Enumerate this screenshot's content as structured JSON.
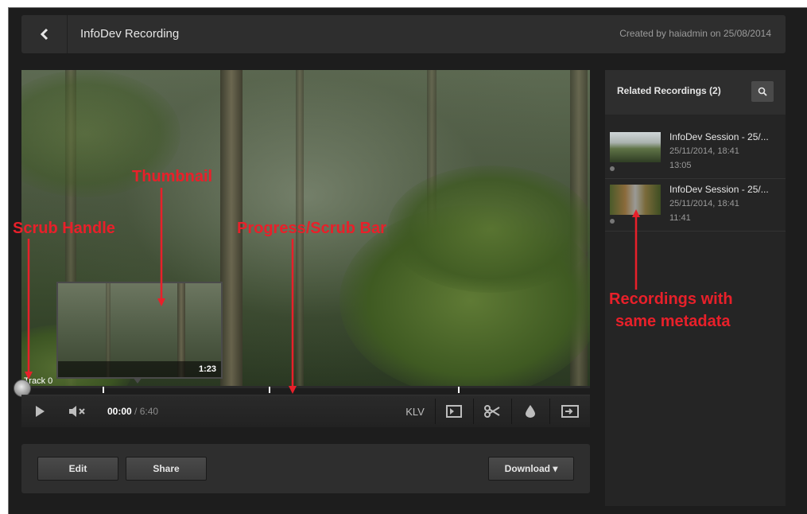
{
  "header": {
    "back_icon": "chevron-left-icon",
    "title": "InfoDev Recording",
    "created": "Created by haiadmin on 25/08/2014"
  },
  "player": {
    "track_label": "Track 0",
    "thumbnail_time": "1:23",
    "time_current": "00:00",
    "time_duration": " / 6:40",
    "klv_label": "KLV",
    "progress": 0.0
  },
  "actions": {
    "edit_label": "Edit",
    "share_label": "Share",
    "download_label": "Download ▾"
  },
  "sidebar": {
    "title": "Related Recordings (2)",
    "items": [
      {
        "title": "InfoDev Session - 25/...",
        "date": "25/11/2014, 18:41",
        "duration": "13:05"
      },
      {
        "title": "InfoDev Session - 25/...",
        "date": "25/11/2014, 18:41",
        "duration": "11:41"
      }
    ]
  },
  "annotations": {
    "scrub_handle": "Scrub Handle",
    "thumbnail": "Thumbnail",
    "progress_bar": "Progress/Scrub Bar",
    "recordings_line1": "Recordings with",
    "recordings_line2": "same metadata"
  },
  "colors": {
    "annotation": "#e8202a",
    "background": "#1d1d1d",
    "panel": "#2e2e2e"
  }
}
